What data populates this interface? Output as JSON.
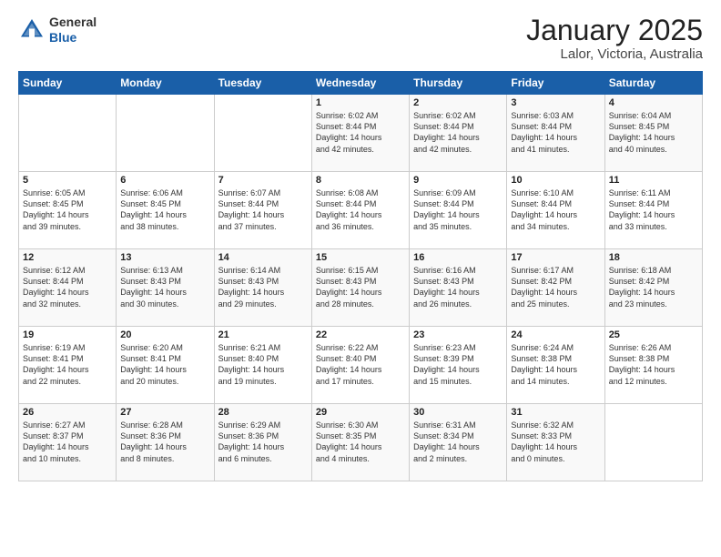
{
  "header": {
    "logo_general": "General",
    "logo_blue": "Blue",
    "title": "January 2025",
    "subtitle": "Lalor, Victoria, Australia"
  },
  "weekdays": [
    "Sunday",
    "Monday",
    "Tuesday",
    "Wednesday",
    "Thursday",
    "Friday",
    "Saturday"
  ],
  "weeks": [
    [
      {
        "day": "",
        "info": ""
      },
      {
        "day": "",
        "info": ""
      },
      {
        "day": "",
        "info": ""
      },
      {
        "day": "1",
        "info": "Sunrise: 6:02 AM\nSunset: 8:44 PM\nDaylight: 14 hours\nand 42 minutes."
      },
      {
        "day": "2",
        "info": "Sunrise: 6:02 AM\nSunset: 8:44 PM\nDaylight: 14 hours\nand 42 minutes."
      },
      {
        "day": "3",
        "info": "Sunrise: 6:03 AM\nSunset: 8:44 PM\nDaylight: 14 hours\nand 41 minutes."
      },
      {
        "day": "4",
        "info": "Sunrise: 6:04 AM\nSunset: 8:45 PM\nDaylight: 14 hours\nand 40 minutes."
      }
    ],
    [
      {
        "day": "5",
        "info": "Sunrise: 6:05 AM\nSunset: 8:45 PM\nDaylight: 14 hours\nand 39 minutes."
      },
      {
        "day": "6",
        "info": "Sunrise: 6:06 AM\nSunset: 8:45 PM\nDaylight: 14 hours\nand 38 minutes."
      },
      {
        "day": "7",
        "info": "Sunrise: 6:07 AM\nSunset: 8:44 PM\nDaylight: 14 hours\nand 37 minutes."
      },
      {
        "day": "8",
        "info": "Sunrise: 6:08 AM\nSunset: 8:44 PM\nDaylight: 14 hours\nand 36 minutes."
      },
      {
        "day": "9",
        "info": "Sunrise: 6:09 AM\nSunset: 8:44 PM\nDaylight: 14 hours\nand 35 minutes."
      },
      {
        "day": "10",
        "info": "Sunrise: 6:10 AM\nSunset: 8:44 PM\nDaylight: 14 hours\nand 34 minutes."
      },
      {
        "day": "11",
        "info": "Sunrise: 6:11 AM\nSunset: 8:44 PM\nDaylight: 14 hours\nand 33 minutes."
      }
    ],
    [
      {
        "day": "12",
        "info": "Sunrise: 6:12 AM\nSunset: 8:44 PM\nDaylight: 14 hours\nand 32 minutes."
      },
      {
        "day": "13",
        "info": "Sunrise: 6:13 AM\nSunset: 8:43 PM\nDaylight: 14 hours\nand 30 minutes."
      },
      {
        "day": "14",
        "info": "Sunrise: 6:14 AM\nSunset: 8:43 PM\nDaylight: 14 hours\nand 29 minutes."
      },
      {
        "day": "15",
        "info": "Sunrise: 6:15 AM\nSunset: 8:43 PM\nDaylight: 14 hours\nand 28 minutes."
      },
      {
        "day": "16",
        "info": "Sunrise: 6:16 AM\nSunset: 8:43 PM\nDaylight: 14 hours\nand 26 minutes."
      },
      {
        "day": "17",
        "info": "Sunrise: 6:17 AM\nSunset: 8:42 PM\nDaylight: 14 hours\nand 25 minutes."
      },
      {
        "day": "18",
        "info": "Sunrise: 6:18 AM\nSunset: 8:42 PM\nDaylight: 14 hours\nand 23 minutes."
      }
    ],
    [
      {
        "day": "19",
        "info": "Sunrise: 6:19 AM\nSunset: 8:41 PM\nDaylight: 14 hours\nand 22 minutes."
      },
      {
        "day": "20",
        "info": "Sunrise: 6:20 AM\nSunset: 8:41 PM\nDaylight: 14 hours\nand 20 minutes."
      },
      {
        "day": "21",
        "info": "Sunrise: 6:21 AM\nSunset: 8:40 PM\nDaylight: 14 hours\nand 19 minutes."
      },
      {
        "day": "22",
        "info": "Sunrise: 6:22 AM\nSunset: 8:40 PM\nDaylight: 14 hours\nand 17 minutes."
      },
      {
        "day": "23",
        "info": "Sunrise: 6:23 AM\nSunset: 8:39 PM\nDaylight: 14 hours\nand 15 minutes."
      },
      {
        "day": "24",
        "info": "Sunrise: 6:24 AM\nSunset: 8:38 PM\nDaylight: 14 hours\nand 14 minutes."
      },
      {
        "day": "25",
        "info": "Sunrise: 6:26 AM\nSunset: 8:38 PM\nDaylight: 14 hours\nand 12 minutes."
      }
    ],
    [
      {
        "day": "26",
        "info": "Sunrise: 6:27 AM\nSunset: 8:37 PM\nDaylight: 14 hours\nand 10 minutes."
      },
      {
        "day": "27",
        "info": "Sunrise: 6:28 AM\nSunset: 8:36 PM\nDaylight: 14 hours\nand 8 minutes."
      },
      {
        "day": "28",
        "info": "Sunrise: 6:29 AM\nSunset: 8:36 PM\nDaylight: 14 hours\nand 6 minutes."
      },
      {
        "day": "29",
        "info": "Sunrise: 6:30 AM\nSunset: 8:35 PM\nDaylight: 14 hours\nand 4 minutes."
      },
      {
        "day": "30",
        "info": "Sunrise: 6:31 AM\nSunset: 8:34 PM\nDaylight: 14 hours\nand 2 minutes."
      },
      {
        "day": "31",
        "info": "Sunrise: 6:32 AM\nSunset: 8:33 PM\nDaylight: 14 hours\nand 0 minutes."
      },
      {
        "day": "",
        "info": ""
      }
    ]
  ]
}
